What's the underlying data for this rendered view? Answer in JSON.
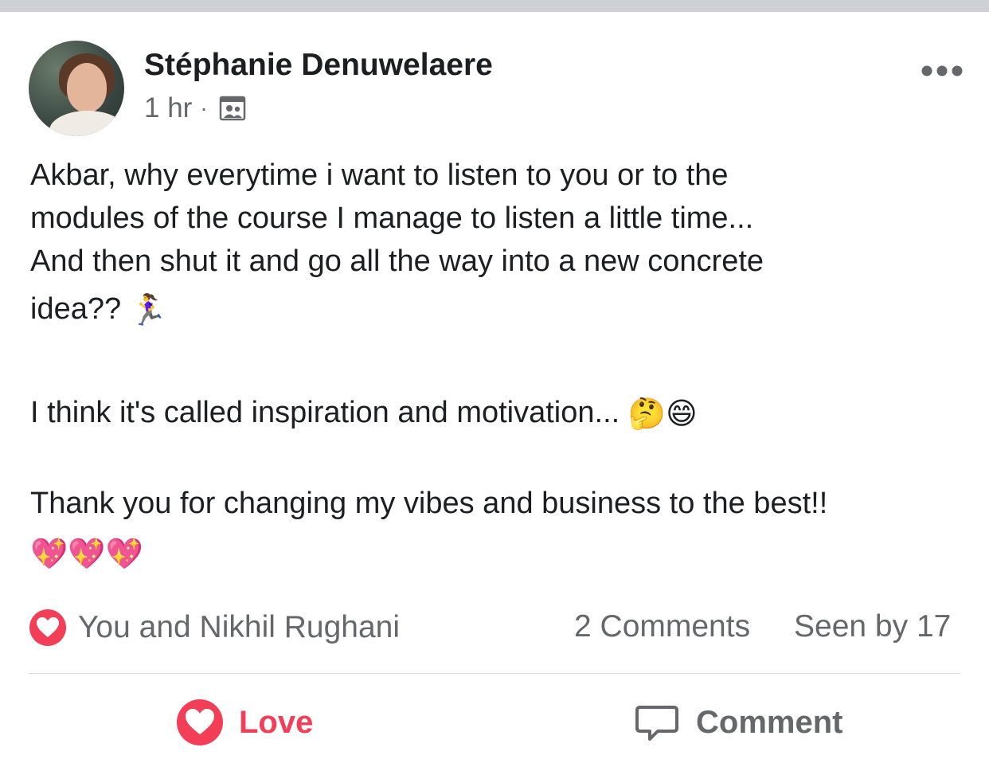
{
  "post": {
    "author": "Stéphanie Denuwelaere",
    "time": "1 hr",
    "separator": "·",
    "audience_icon": "group-icon",
    "more_icon": "more-dots-icon",
    "paragraphs": {
      "p1_line1": "Akbar, why everytime i want to listen to you or to the",
      "p1_line2": "modules of the course I manage to listen a little time...",
      "p1_line3": "And then shut it and go all the way into a new concrete",
      "p1_line4": "idea??",
      "p1_emoji": "🏃‍♀️",
      "p2": "I think it's called inspiration and motivation...",
      "p2_emoji": "🤔😄",
      "p3": "Thank you for changing my vibes and business to the best!!",
      "p3_emoji": "💖💖💖"
    }
  },
  "stats": {
    "reaction_icon": "heart-reaction-icon",
    "reactors": "You and Nikhil Rughani",
    "comments": "2 Comments",
    "seen": "Seen by 17"
  },
  "actions": {
    "love_label": "Love",
    "love_icon": "heart-icon",
    "comment_label": "Comment",
    "comment_icon": "speech-bubble-icon"
  },
  "colors": {
    "love": "#f33e58",
    "secondary_text": "#65676b",
    "primary_text": "#1c1e21",
    "divider": "#dadde1",
    "top_bar": "#cdd0d4"
  }
}
